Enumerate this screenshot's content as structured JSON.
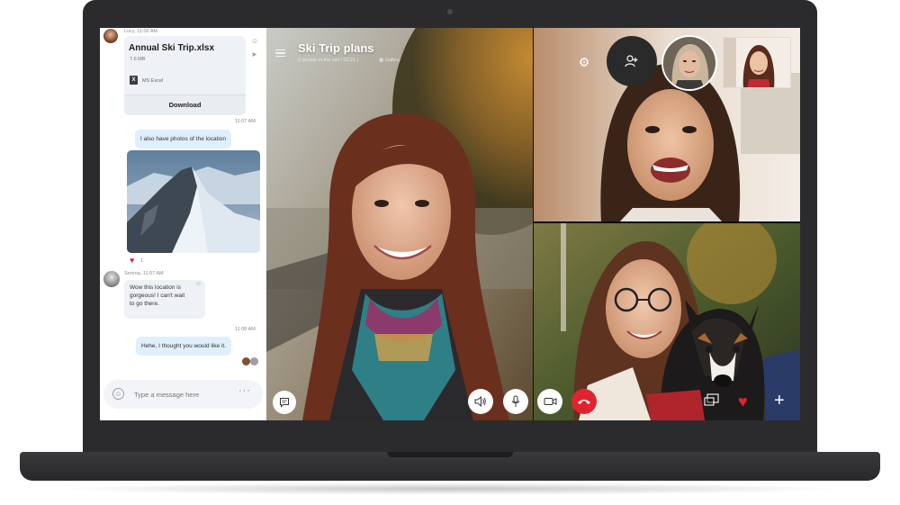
{
  "chat": {
    "file_sender_meta": "Lucy, 11:00 AM",
    "file": {
      "name": "Annual Ski Trip.xlsx",
      "size": "7.6 MB",
      "app_icon": "excel-icon",
      "app_label": "MS Excel",
      "download_label": "Download"
    },
    "messages": [
      {
        "time": "11:07 AM",
        "text": "I also have photos of the location"
      },
      {
        "reaction_count": "1"
      },
      {
        "sender_meta": "Serena, 11:07 AM",
        "lines": [
          "Wow this location is",
          "gorgeous! I can't wait",
          "to go there."
        ]
      },
      {
        "time": "11:08 AM",
        "text": "Hehe, I thought you would like it."
      }
    ],
    "composer": {
      "placeholder": "Type a message here",
      "more": "···"
    }
  },
  "call": {
    "title": "Ski Trip plans",
    "subtitle": "3 people in the call | 02:21 |",
    "view_mode": "Gallery"
  },
  "controls": {
    "chat": "chat-bubble-icon",
    "speaker": "speaker-icon",
    "mic": "microphone-icon",
    "video": "video-camera-icon",
    "end": "end-call-icon",
    "share": "screen-share-icon",
    "react": "heart-icon",
    "more": "+",
    "settings": "gear-icon",
    "add_people": "add-person-icon"
  },
  "colors": {
    "accent_blue": "#dfeffc",
    "end_call_red": "#e0242f",
    "laptop_body": "#2b2b2d"
  }
}
